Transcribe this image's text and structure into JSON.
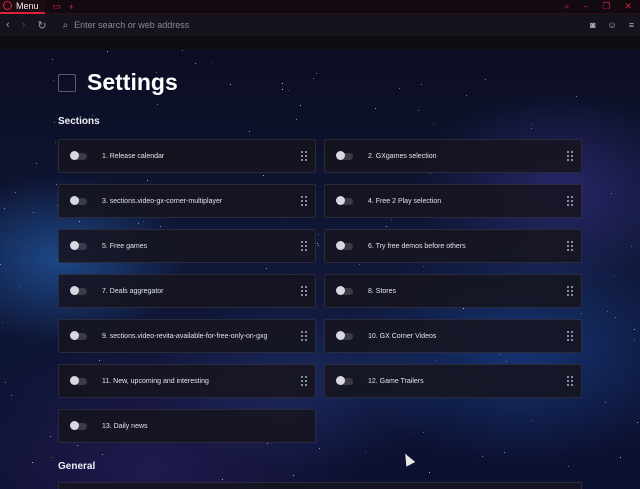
{
  "titlebar": {
    "menu_label": "Menu",
    "icons": [
      "opera-gx-logo-icon",
      "tab-icon",
      "new-tab-icon",
      "search-icon",
      "minimize-icon",
      "restore-icon",
      "close-icon"
    ]
  },
  "addressbar": {
    "placeholder": "Enter search or web address",
    "value": "",
    "icons": [
      "back-icon",
      "forward-icon",
      "reload-icon",
      "search-icon",
      "camera-icon",
      "account-icon",
      "menu-icon"
    ]
  },
  "page": {
    "title": "Settings",
    "sections_heading": "Sections",
    "general_heading": "General"
  },
  "sections": [
    {
      "label": "1. Release calendar",
      "enabled": false
    },
    {
      "label": "2. GXgames selection",
      "enabled": false
    },
    {
      "label": "3. sections.video-gx-corner-multiplayer",
      "enabled": false
    },
    {
      "label": "4. Free 2 Play selection",
      "enabled": false
    },
    {
      "label": "5. Free games",
      "enabled": false
    },
    {
      "label": "6. Try free demos before others",
      "enabled": false
    },
    {
      "label": "7. Deals aggregator",
      "enabled": false
    },
    {
      "label": "8. Stores",
      "enabled": false
    },
    {
      "label": "9. sections.video-revita-available-for-free-only-on-gxg",
      "enabled": false
    },
    {
      "label": "10. GX Corner Videos",
      "enabled": false
    },
    {
      "label": "11. New, upcoming and interesting",
      "enabled": false
    },
    {
      "label": "12. Game Trailers",
      "enabled": false
    },
    {
      "label": "13. Daily news",
      "enabled": false
    }
  ],
  "colors": {
    "accent": "#e0203a",
    "card_bg": "#16141f",
    "text": "#e4e4ea"
  }
}
